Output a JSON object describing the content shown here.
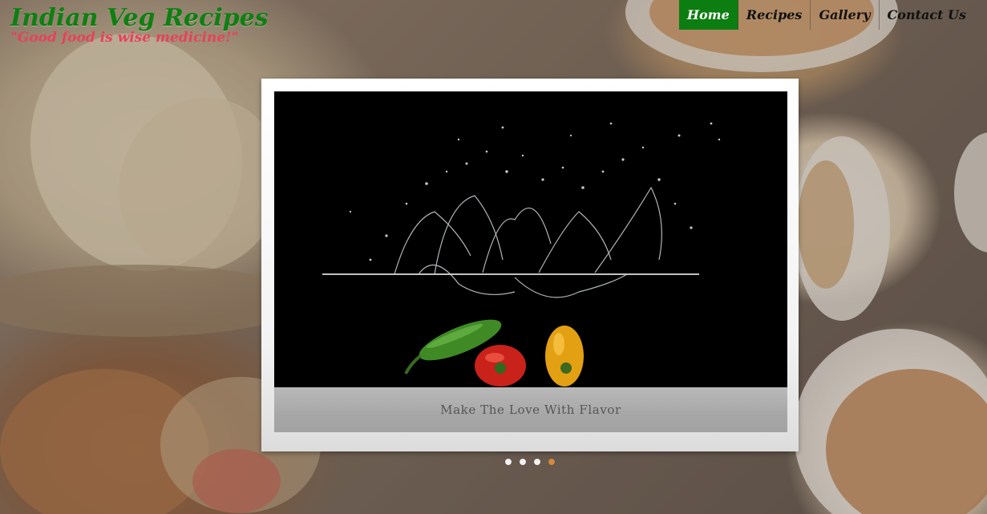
{
  "site": {
    "title": "Indian Veg Recipes",
    "tagline": "\"Good food is wise medicine!\""
  },
  "nav": {
    "items": [
      {
        "label": "Home",
        "active": true
      },
      {
        "label": "Recipes",
        "active": false
      },
      {
        "label": "Gallery",
        "active": false
      },
      {
        "label": "Contact Us",
        "active": false
      }
    ]
  },
  "slider": {
    "caption": "Make The Love With Flavor",
    "slide_count": 4,
    "active_index": 3,
    "image_icon": "water-splash-vegetables-image"
  },
  "colors": {
    "brand_green": "#0c7d10",
    "tagline_pink": "#e8415c",
    "active_dot": "#d38a3e"
  }
}
